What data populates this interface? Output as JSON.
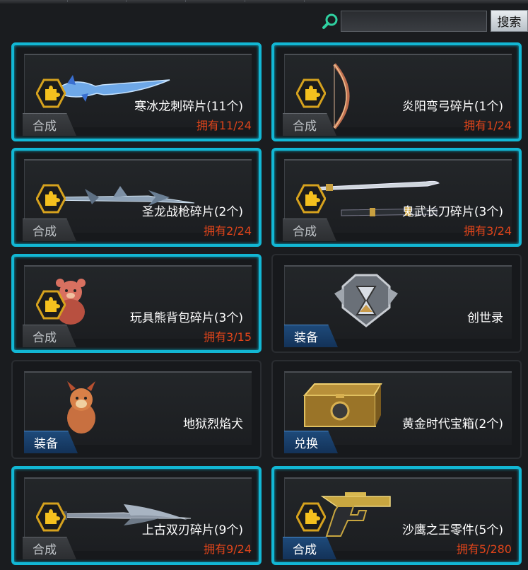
{
  "search": {
    "button_label": "搜索",
    "placeholder": ""
  },
  "items": [
    {
      "name": "寒冰龙刺碎片(11个)",
      "owned": "拥有11/24",
      "action": "合成",
      "action_style": "gray",
      "highlight": true,
      "puzzle": true,
      "art": "ice-dagger"
    },
    {
      "name": "炎阳弯弓碎片(1个)",
      "owned": "拥有1/24",
      "action": "合成",
      "action_style": "gray",
      "highlight": true,
      "puzzle": true,
      "art": "bow"
    },
    {
      "name": "圣龙战枪碎片(2个)",
      "owned": "拥有2/24",
      "action": "合成",
      "action_style": "gray",
      "highlight": true,
      "puzzle": true,
      "art": "spear"
    },
    {
      "name": "鬼武长刀碎片(3个)",
      "owned": "拥有3/24",
      "action": "合成",
      "action_style": "gray",
      "highlight": true,
      "puzzle": true,
      "art": "katana"
    },
    {
      "name": "玩具熊背包碎片(3个)",
      "owned": "拥有3/15",
      "action": "合成",
      "action_style": "gray",
      "highlight": true,
      "puzzle": true,
      "art": "bear"
    },
    {
      "name": "创世录",
      "owned": "",
      "action": "装备",
      "action_style": "blue",
      "highlight": false,
      "puzzle": false,
      "art": "hourglass-badge"
    },
    {
      "name": "地狱烈焰犬",
      "owned": "",
      "action": "装备",
      "action_style": "blue",
      "highlight": false,
      "puzzle": false,
      "art": "dog"
    },
    {
      "name": "黄金时代宝箱(2个)",
      "owned": "",
      "action": "兑换",
      "action_style": "blue",
      "highlight": false,
      "puzzle": false,
      "art": "chest"
    },
    {
      "name": "上古双刃碎片(9个)",
      "owned": "拥有9/24",
      "action": "合成",
      "action_style": "gray",
      "highlight": true,
      "puzzle": true,
      "art": "double-blade"
    },
    {
      "name": "沙鹰之王零件(5个)",
      "owned": "拥有5/280",
      "action": "合成",
      "action_style": "blue",
      "highlight": true,
      "puzzle": true,
      "art": "pistol"
    }
  ]
}
